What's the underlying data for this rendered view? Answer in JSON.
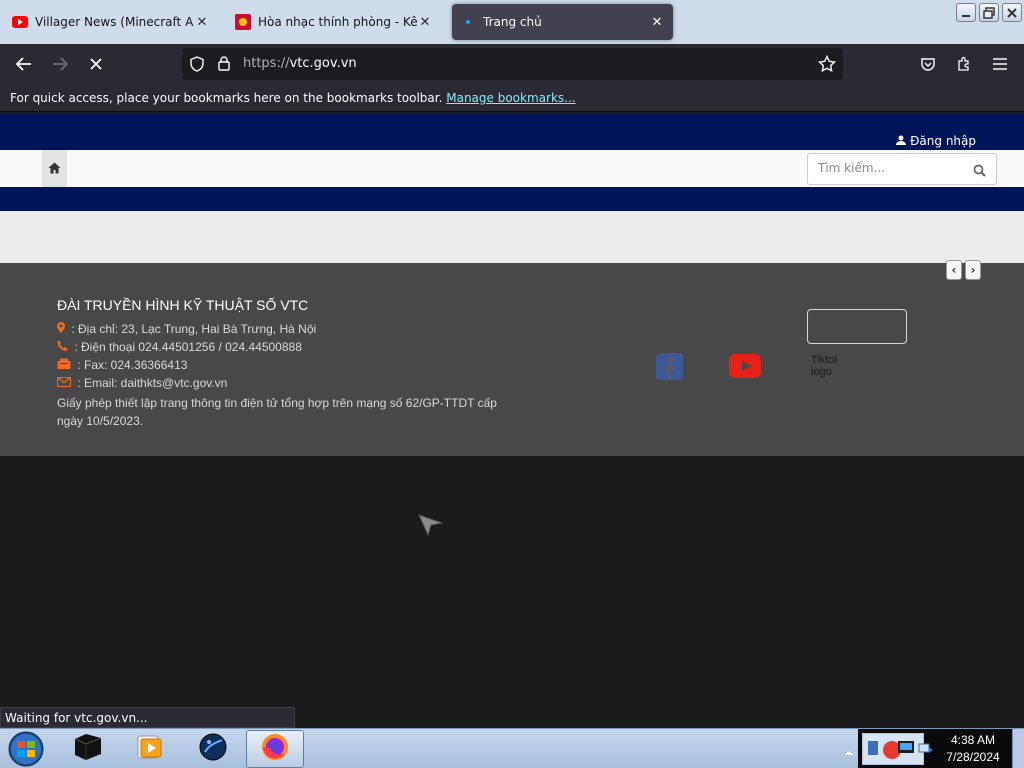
{
  "browser": {
    "tabs": [
      {
        "title": "Villager News (Minecraft Anima",
        "favicon": "youtube-icon",
        "active": false
      },
      {
        "title": "Hòa nhạc thính phòng - Kênh V",
        "favicon": "vtc-icon",
        "active": false
      },
      {
        "title": "Trang chủ",
        "favicon": "loading-icon",
        "active": true
      }
    ],
    "url": {
      "scheme": "https://",
      "host": "vtc.gov.vn"
    },
    "bookmarks_bar": {
      "message": "For quick access, place your bookmarks here on the bookmarks toolbar.",
      "link": "Manage bookmarks..."
    },
    "status_text": "Waiting for vtc.gov.vn..."
  },
  "site": {
    "login_label": "Đăng nhập",
    "search_placeholder": "Tìm kiếm...",
    "footer": {
      "title": "ĐÀI TRUYỀN HÌNH KỸ THUẬT SỐ VTC",
      "address": ": Địa chỉ: 23, Lạc Trung, Hai Bà Trưng, Hà Nội",
      "phone": ": Điện thoại 024.44501256 / 024.44500888",
      "fax": ": Fax: 024.36366413",
      "email": ": Email: daithkts@vtc.gov.vn",
      "license": "Giấy phép thiết lập trang thông tin điện tử tổng hợp trên mạng số 62/GP-TTDT cấp ngày 10/5/2023.",
      "tiktok_alt": "Tiktok logo"
    }
  },
  "taskbar": {
    "time": "4:38 AM",
    "date": "7/28/2024"
  },
  "colors": {
    "site_navy": "#001459",
    "footer_grey": "#484848",
    "accent_orange": "#f26b21",
    "browser_toolbar": "#2b2a33"
  }
}
